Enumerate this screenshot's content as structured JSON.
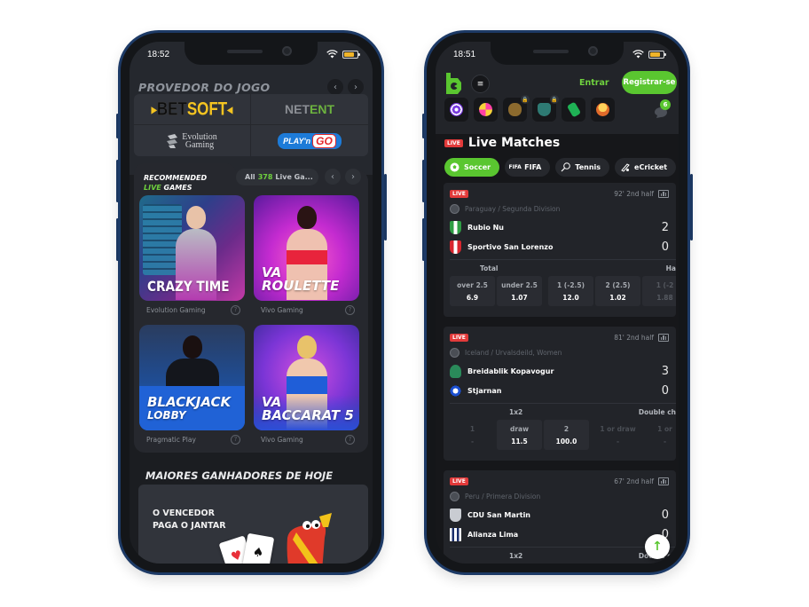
{
  "left_phone": {
    "status_time": "18:52",
    "provider_section": {
      "title": "PROVEDOR DO JOGO",
      "prev_icon": "chevron-left-icon",
      "next_icon": "chevron-right-icon",
      "providers": [
        {
          "name": "BETSOFT",
          "part1": "BET",
          "part2": "SOFT"
        },
        {
          "name": "NETENT",
          "part1": "NET",
          "part2": "ENT"
        },
        {
          "name": "Evolution Gaming",
          "line1": "Evolution",
          "line2": "Gaming"
        },
        {
          "name": "PLAY'n GO",
          "part1": "PLAY'n",
          "part2": "GO"
        }
      ]
    },
    "recommended": {
      "title_line1": "RECOMMENDED",
      "title_live": "LIVE",
      "title_games": " GAMES",
      "all_label": "All",
      "all_count": "378",
      "all_suffix": "Live Ga...",
      "games": [
        {
          "title": "CRAZY TIME",
          "provider": "Evolution Gaming"
        },
        {
          "title_line1": "VA",
          "title_line2": "ROULETTE",
          "provider": "Vivo Gaming"
        },
        {
          "title_line1": "BLACKJACK",
          "title_line2": "LOBBY",
          "provider": "Pragmatic Play"
        },
        {
          "title_line1": "VA",
          "title_line2": "BACCARAT 5",
          "provider": "Vivo Gaming"
        }
      ],
      "help_glyph": "?"
    },
    "winners": {
      "title": "MAIORES GANHADORES DE HOJE",
      "banner_line1": "O VENCEDOR",
      "banner_line2": "PAGA O JANTAR",
      "card1": "♥",
      "card2": "♠"
    }
  },
  "right_phone": {
    "status_time": "18:51",
    "header": {
      "menu_glyph": "≡",
      "login_label": "Entrar",
      "register_label": "Registrar-se",
      "chat_badge": "6"
    },
    "quick_links": [
      {
        "icon": "target-icon",
        "locked": false
      },
      {
        "icon": "wheel-icon",
        "locked": false
      },
      {
        "icon": "piggy-bank-icon",
        "locked": true
      },
      {
        "icon": "robot-icon",
        "locked": true
      },
      {
        "icon": "cash-tag-icon",
        "locked": false
      },
      {
        "icon": "coin-stack-icon",
        "locked": false
      }
    ],
    "live_section": {
      "live_tag": "LIVE",
      "title": "Live Matches",
      "sport_tabs": [
        {
          "label": "Soccer",
          "icon": "soccer-ball-icon",
          "active": true
        },
        {
          "label": "FIFA",
          "icon": "fifa-icon",
          "active": false
        },
        {
          "label": "Tennis",
          "icon": "tennis-racket-icon",
          "active": false
        },
        {
          "label": "eCricket",
          "icon": "cricket-icon",
          "active": false
        }
      ]
    },
    "matches": [
      {
        "live_tag": "LIVE",
        "time": "92' 2nd half",
        "league": "Paraguay / Segunda Division",
        "home": {
          "name": "Rubio Nu",
          "score": "2"
        },
        "away": {
          "name": "Sportivo San Lorenzo",
          "score": "0"
        },
        "market1": "Total",
        "market2": "Ha",
        "odds": [
          {
            "label": "over 2.5",
            "value": "6.9"
          },
          {
            "label": "under 2.5",
            "value": "1.07"
          },
          {
            "label": "1 (-2.5)",
            "value": "12.0"
          },
          {
            "label": "2 (2.5)",
            "value": "1.02"
          },
          {
            "label": "1 (-2",
            "value": "1.88"
          }
        ]
      },
      {
        "live_tag": "LIVE",
        "time": "81' 2nd half",
        "league": "Iceland / Urvalsdeild, Women",
        "home": {
          "name": "Breidablik Kopavogur",
          "score": "3"
        },
        "away": {
          "name": "Stjarnan",
          "score": "0"
        },
        "market1": "1x2",
        "market2": "Double ch",
        "odds": [
          {
            "label": "1",
            "value": "-"
          },
          {
            "label": "draw",
            "value": "11.5"
          },
          {
            "label": "2",
            "value": "100.0"
          },
          {
            "label": "1 or draw",
            "value": "-"
          },
          {
            "label": "1 or",
            "value": "-"
          }
        ]
      },
      {
        "live_tag": "LIVE",
        "time": "67' 2nd half",
        "league": "Peru / Primera Division",
        "home": {
          "name": "CDU San Martin",
          "score": "0"
        },
        "away": {
          "name": "Alianza Lima",
          "score": "0"
        },
        "market1": "1x2",
        "market2": "Double ch"
      }
    ],
    "scroll_top_glyph": "↑"
  }
}
